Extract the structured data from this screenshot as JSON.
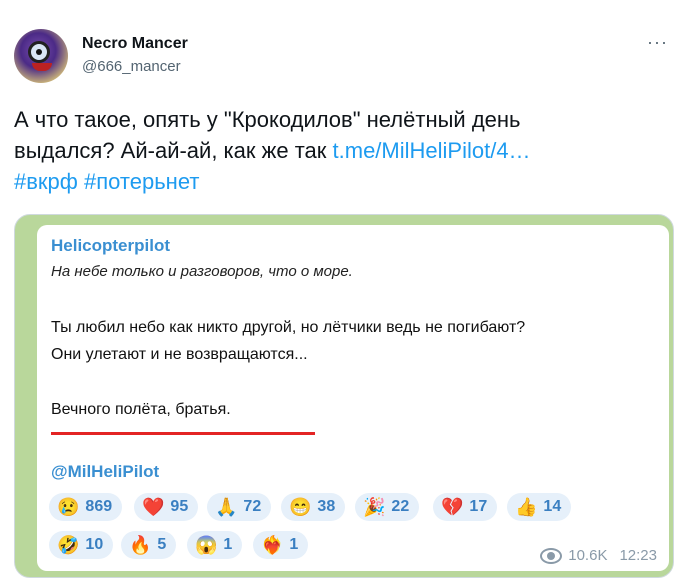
{
  "author": {
    "name": "Necro Mancer",
    "handle": "@666_mancer",
    "more": "···"
  },
  "tweet": {
    "line1": "А что такое, опять у \"Крокодилов\" нелётный день",
    "line2_text": "выдался? Ай-ай-ай, как же так ",
    "line2_link": "t.me/MilHeliPilot/4…",
    "hashtag1": "#вкрф",
    "hashtag2": "#потерьнет"
  },
  "telegram": {
    "channel": "Helicopterpilot",
    "subtitle": "На небе только и разговоров, что о море.",
    "line1": "Ты любил небо как никто другой, но лётчики ведь не погибают?",
    "line2": "Они улетают и не возвращаются...",
    "line3": "Вечного полёта, братья.",
    "handle": "@MilHeliPilot",
    "views": "10.6K",
    "time": "12:23",
    "reactions": [
      {
        "emoji": "😢",
        "count": "869"
      },
      {
        "emoji": "❤️",
        "count": "95"
      },
      {
        "emoji": "🙏",
        "count": "72"
      },
      {
        "emoji": "😁",
        "count": "38"
      },
      {
        "emoji": "🎉",
        "count": "22"
      },
      {
        "emoji": "💔",
        "count": "17"
      },
      {
        "emoji": "👍",
        "count": "14"
      },
      {
        "emoji": "🤣",
        "count": "10"
      },
      {
        "emoji": "🔥",
        "count": "5"
      },
      {
        "emoji": "😱",
        "count": "1"
      },
      {
        "emoji": "❤️‍🔥",
        "count": "1"
      }
    ]
  }
}
